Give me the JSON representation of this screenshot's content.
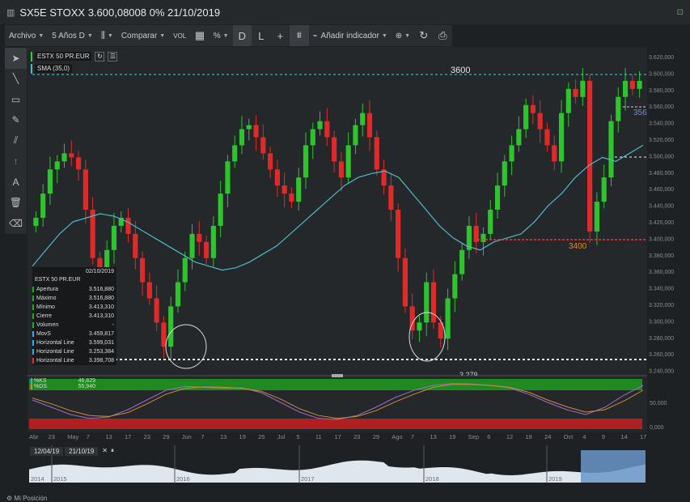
{
  "window": {
    "title": "SX5E STOXX 3.600,08008 0% 21/10/2019"
  },
  "toolbar": {
    "archivo": "Archivo",
    "period": "5 Años D",
    "comparar": "Comparar",
    "vol": "VOL",
    "percent": "%",
    "d": "D",
    "l": "L",
    "add_indicator": "Añadir indicador"
  },
  "sidebar": {
    "icons": [
      "cursor-icon",
      "line-tool-icon",
      "rectangle-tool-icon",
      "brush-tool-icon",
      "channel-tool-icon",
      "arrow-tool-icon",
      "text-tool-icon",
      "trash-icon",
      "eraser-icon"
    ],
    "text_tool": "A"
  },
  "legend": {
    "instrument": "ESTX 50 PR.EUR",
    "sma": "SMA (35,0)",
    "colors": {
      "instrument": "#33cc33",
      "sma": "#4fb8c8"
    }
  },
  "info_panel": {
    "date": "02/10/2019",
    "name": "ESTX 50 PR.EUR",
    "rows": [
      {
        "label": "Apertura",
        "value": "3.516,880"
      },
      {
        "label": "Máximo",
        "value": "3.516,880"
      },
      {
        "label": "Mínimo",
        "value": "3.413,310"
      },
      {
        "label": "Cierre",
        "value": "3.413,310"
      },
      {
        "label": "Volumen",
        "value": "-"
      },
      {
        "label": "MovS",
        "value": "3.459,817"
      },
      {
        "label": "Horizontal Line",
        "value": "3.599,031"
      },
      {
        "label": "Horizontal Line",
        "value": "3.253,384"
      },
      {
        "label": "Horizontal Line",
        "value": "3.398,708"
      }
    ]
  },
  "annotations": {
    "level_3600": "3600",
    "level_3400": "3400",
    "level_3279": "3.279",
    "level_356": "356"
  },
  "price_axis": [
    "3.620,000",
    "3.600,000",
    "3.580,000",
    "3.560,000",
    "3.540,000",
    "3.520,000",
    "3.500,000",
    "3.480,000",
    "3.460,000",
    "3.440,000",
    "3.420,000",
    "3.400,000",
    "3.380,000",
    "3.360,000",
    "3.340,000",
    "3.320,000",
    "3.300,000",
    "3.280,000",
    "3.260,000",
    "3.240,000"
  ],
  "oscillator": {
    "ks_label": "%KS",
    "ks_value": "46,829",
    "ds_label": "%DS",
    "ds_value": "55,940",
    "axis": [
      "50,000",
      "0,000"
    ],
    "colors": {
      "ks": "#9a6cc8",
      "ds": "#d08a3a"
    }
  },
  "date_axis": [
    "Abr",
    "23",
    "May",
    "7",
    "13",
    "17",
    "23",
    "29",
    "Jun",
    "7",
    "13",
    "19",
    "25",
    "Jul",
    "5",
    "11",
    "17",
    "23",
    "29",
    "Ago",
    "7",
    "13",
    "19",
    "Sep",
    "6",
    "12",
    "18",
    "24",
    "Oct",
    "4",
    "9",
    "14",
    "17"
  ],
  "navigator": {
    "start_date": "12/04/19",
    "end_date": "21/10/19",
    "years": [
      "2014",
      "2015",
      "2016",
      "2017",
      "2018",
      "2019"
    ]
  },
  "footer": {
    "text": "Mi Posición"
  },
  "chart_data": {
    "type": "candlestick",
    "title": "SX5E STOXX 3.600,08008 0% 21/10/2019",
    "ylim": [
      3240,
      3630
    ],
    "close_series": [
      3430,
      3460,
      3490,
      3500,
      3510,
      3505,
      3490,
      3440,
      3380,
      3360,
      3390,
      3420,
      3430,
      3410,
      3380,
      3350,
      3330,
      3300,
      3270,
      3320,
      3350,
      3380,
      3410,
      3400,
      3380,
      3420,
      3460,
      3500,
      3520,
      3540,
      3545,
      3530,
      3510,
      3490,
      3470,
      3460,
      3450,
      3480,
      3520,
      3540,
      3550,
      3530,
      3500,
      3480,
      3520,
      3545,
      3560,
      3530,
      3490,
      3470,
      3440,
      3380,
      3320,
      3290,
      3300,
      3350,
      3300,
      3280,
      3330,
      3360,
      3390,
      3420,
      3400,
      3410,
      3440,
      3470,
      3500,
      3520,
      3540,
      3570,
      3560,
      3540,
      3520,
      3500,
      3560,
      3590,
      3580,
      3600,
      3413,
      3450,
      3480,
      3550,
      3580,
      3600,
      3590,
      3600
    ],
    "sma_series": [
      3370,
      3390,
      3410,
      3425,
      3430,
      3435,
      3432,
      3425,
      3415,
      3405,
      3395,
      3385,
      3375,
      3370,
      3365,
      3368,
      3375,
      3385,
      3395,
      3410,
      3425,
      3440,
      3455,
      3470,
      3480,
      3485,
      3488,
      3480,
      3460,
      3440,
      3420,
      3405,
      3395,
      3390,
      3400,
      3405,
      3410,
      3425,
      3445,
      3460,
      3480,
      3495,
      3505,
      3500,
      3510,
      3520
    ],
    "horizontal_lines": [
      3599.031,
      3253.384,
      3398.708
    ],
    "stochastic_ks": [
      60,
      45,
      30,
      22,
      25,
      40,
      60,
      80,
      88,
      86,
      84,
      85,
      75,
      55,
      35,
      22,
      20,
      28,
      45,
      65,
      80,
      90,
      94,
      93,
      90,
      85,
      72,
      55,
      40,
      30,
      45,
      70,
      90
    ],
    "stochastic_ds": [
      64,
      52,
      38,
      28,
      26,
      34,
      52,
      72,
      84,
      87,
      86,
      84,
      78,
      62,
      42,
      28,
      22,
      26,
      38,
      56,
      72,
      86,
      92,
      92,
      90,
      86,
      76,
      60,
      46,
      35,
      40,
      58,
      80
    ]
  }
}
